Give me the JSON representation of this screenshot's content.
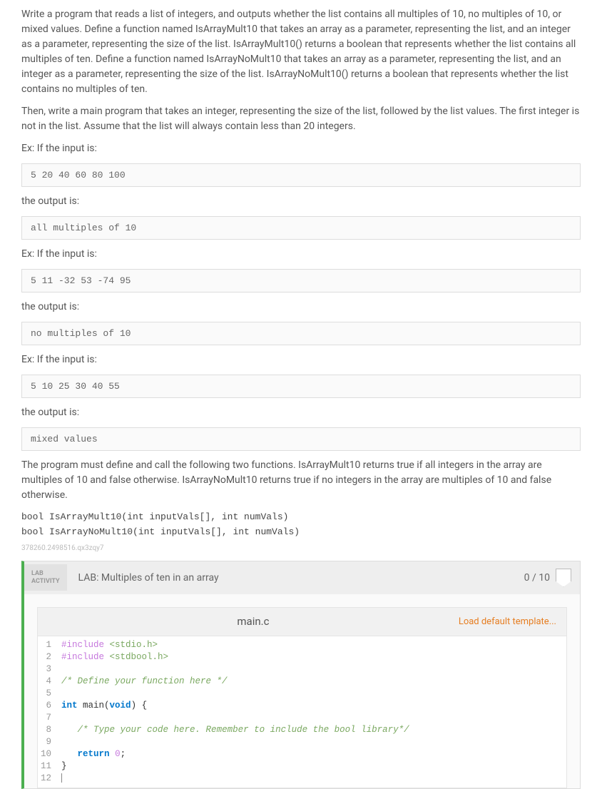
{
  "problem": {
    "intro": "Write a program that reads a list of integers, and outputs whether the list contains all multiples of 10, no multiples of 10, or mixed values. Define a function named IsArrayMult10 that takes an array as a parameter, representing the list, and an integer as a parameter, representing the size of the list. IsArrayMult10() returns a boolean that represents whether the list contains all multiples of ten. Define a function named IsArrayNoMult10 that takes an array as a parameter, representing the list, and an integer as a parameter, representing the size of the list. IsArrayNoMult10() returns a boolean that represents whether the list contains no multiples of ten.",
    "main_desc": "Then, write a main program that takes an integer, representing the size of the list, followed by the list values. The first integer is not in the list. Assume that the list will always contain less than 20 integers.",
    "ex_label_1": "Ex: If the input is:",
    "input_1": "5 20 40 60 80 100",
    "out_label_1": "the output is:",
    "output_1": "all multiples of 10",
    "ex_label_2": "Ex: If the input is:",
    "input_2": "5 11 -32 53 -74 95",
    "out_label_2": "the output is:",
    "output_2": "no multiples of 10",
    "ex_label_3": "Ex: If the input is:",
    "input_3": "5 10 25 30 40 55",
    "out_label_3": "the output is:",
    "output_3": "mixed values",
    "funcs_desc": "The program must define and call the following two functions. IsArrayMult10 returns true if all integers in the array are multiples of 10 and false otherwise. IsArrayNoMult10 returns true if no integers in the array are multiples of 10 and false otherwise.",
    "sig_1": "bool IsArrayMult10(int inputVals[], int numVals)",
    "sig_2": "bool IsArrayNoMult10(int inputVals[], int numVals)",
    "qid": "378260.2498516.qx3zqy7"
  },
  "lab": {
    "badge_line1": "LAB",
    "badge_line2": "ACTIVITY",
    "title": "LAB: Multiples of ten in an array",
    "score": "0 / 10",
    "filename": "main.c",
    "load_template": "Load default template..."
  },
  "code": {
    "lines": [
      {
        "n": 1,
        "type": "pp",
        "pp": "#include ",
        "inc": "<stdio.h>"
      },
      {
        "n": 2,
        "type": "pp",
        "pp": "#include ",
        "inc": "<stdbool.h>"
      },
      {
        "n": 3,
        "type": "blank"
      },
      {
        "n": 4,
        "type": "cmt",
        "text": "/* Define your function here */"
      },
      {
        "n": 5,
        "type": "blank"
      },
      {
        "n": 6,
        "type": "main",
        "kw_int": "int",
        "fn": " main(",
        "kw_void": "void",
        "tail": ") {"
      },
      {
        "n": 7,
        "type": "blank"
      },
      {
        "n": 8,
        "type": "cmt_indent",
        "text": "/* Type your code here. Remember to include the bool library*/"
      },
      {
        "n": 9,
        "type": "blank"
      },
      {
        "n": 10,
        "type": "ret",
        "kw": "return",
        "num": "0"
      },
      {
        "n": 11,
        "type": "brace",
        "text": "}"
      },
      {
        "n": 12,
        "type": "caret"
      }
    ]
  }
}
